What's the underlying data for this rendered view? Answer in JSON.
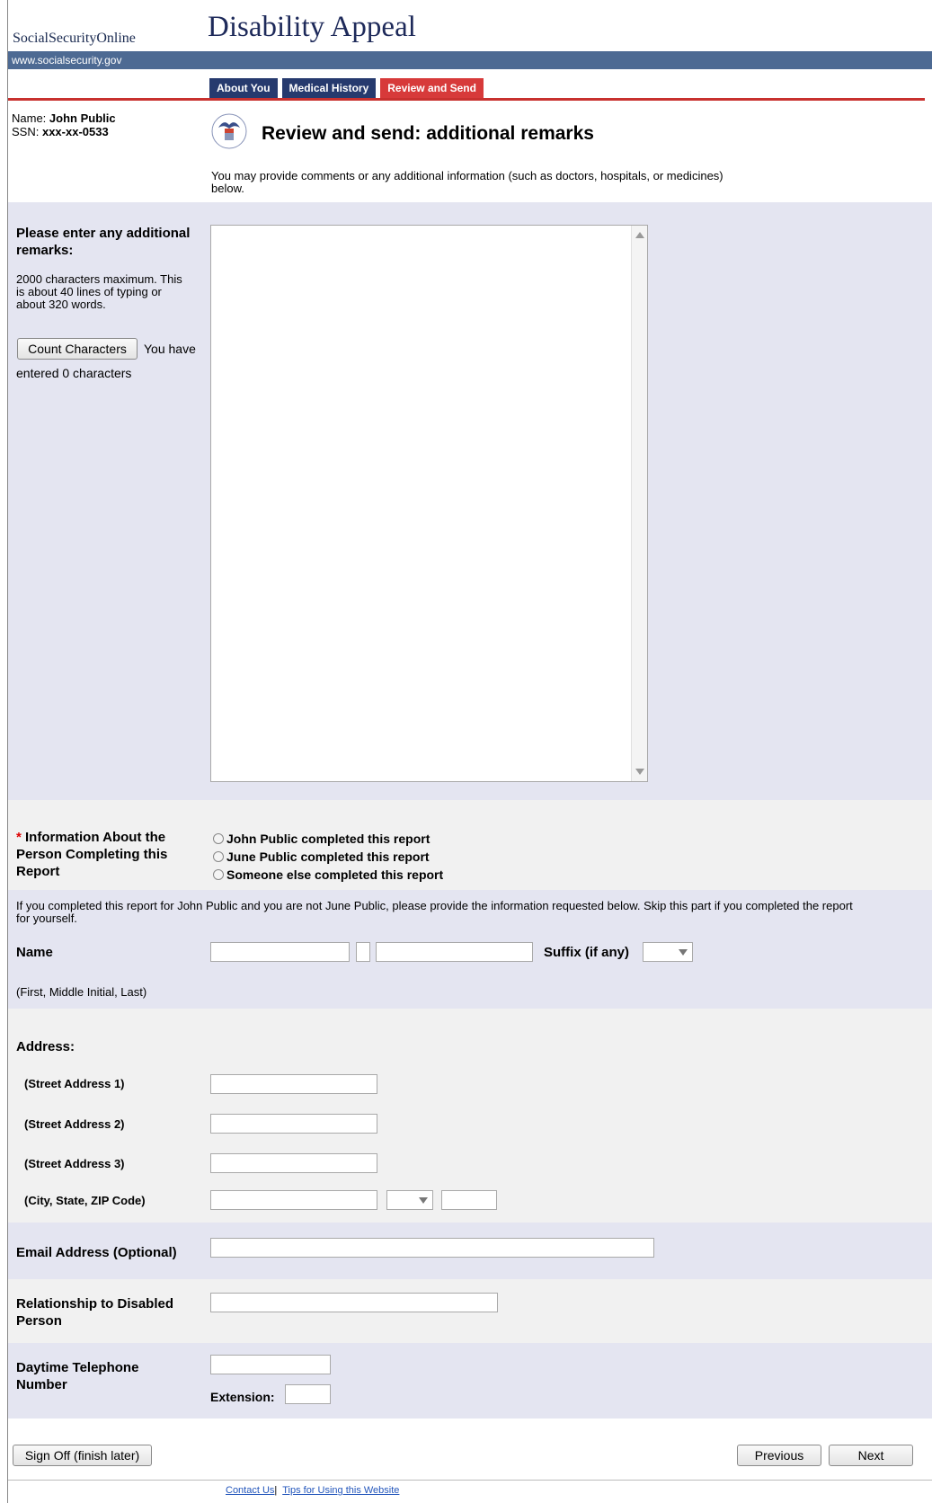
{
  "header": {
    "brand": "SocialSecurityOnline",
    "title": "Disability Appeal",
    "url": "www.socialsecurity.gov"
  },
  "tabs": [
    {
      "label": "About You",
      "active": false
    },
    {
      "label": "Medical History",
      "active": false
    },
    {
      "label": "Review and Send",
      "active": true
    }
  ],
  "user": {
    "name_label": "Name:",
    "name": "John Public",
    "ssn_label": "SSN:",
    "ssn": "xxx-xx-0533"
  },
  "page": {
    "heading": "Review and send: additional remarks",
    "intro": "You may provide comments or any additional information (such as doctors, hospitals, or medicines) below."
  },
  "remarks": {
    "label": "Please enter any additional remarks:",
    "limit_text": "2000 characters maximum. This is about 40 lines of typing or about 320 words.",
    "count_button": "Count Characters",
    "count_text_1": "You have",
    "count_text_2": "entered 0 characters",
    "value": ""
  },
  "completer": {
    "required_mark": "*",
    "label": "Information About the Person Completing this Report",
    "options": [
      "John Public completed this report",
      "June Public completed this report",
      "Someone else completed this report"
    ]
  },
  "instructions": "If you completed this report for John Public and you are not June Public, please provide the information requested below. Skip this part if you completed the report for yourself.",
  "name_section": {
    "label": "Name",
    "hint": "(First, Middle Initial, Last)",
    "suffix_label": "Suffix (if any)",
    "first": "",
    "middle": "",
    "last": "",
    "suffix": ""
  },
  "address": {
    "label": "Address:",
    "street1": "(Street Address 1)",
    "street2": "(Street Address 2)",
    "street3": "(Street Address 3)",
    "city_state_zip": "(City, State, ZIP Code)"
  },
  "email": {
    "label": "Email Address (Optional)",
    "value": ""
  },
  "relationship": {
    "label": "Relationship to Disabled Person",
    "value": ""
  },
  "phone": {
    "label": "Daytime Telephone Number",
    "extension_label": "Extension:",
    "value": "",
    "extension": ""
  },
  "buttons": {
    "sign_off": "Sign Off (finish later)",
    "previous": "Previous",
    "next": "Next"
  },
  "footer": {
    "contact": "Contact Us",
    "separator": "|",
    "tips": "Tips for Using this Website"
  },
  "colors": {
    "tab_bg": "#263a6e",
    "tab_active_bg": "#d73a3a",
    "url_bar": "#4d6a93",
    "section_lavender": "#e4e5f1",
    "section_gray": "#f1f1f1"
  }
}
